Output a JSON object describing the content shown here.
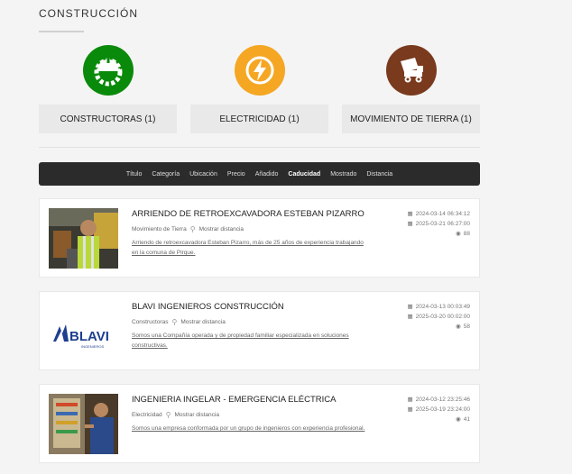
{
  "header": {
    "title": "CONSTRUCCIÓN"
  },
  "categories": [
    {
      "label": "CONSTRUCTORAS (1)",
      "icon": "hardhat-gear-icon",
      "color": "#0a8a0a"
    },
    {
      "label": "ELECTRICIDAD (1)",
      "icon": "lightning-icon",
      "color": "#f5a623"
    },
    {
      "label": "MOVIMIENTO DE TIERRA (1)",
      "icon": "dump-truck-icon",
      "color": "#7a3a1d"
    }
  ],
  "sortbar": {
    "items": [
      "Título",
      "Categoría",
      "Ubicación",
      "Precio",
      "Añadido",
      "Caducidad",
      "Mostrado",
      "Distancia"
    ],
    "active": "Caducidad"
  },
  "listings": [
    {
      "title": "ARRIENDO DE RETROEXCAVADORA ESTEBAN PIZARRO",
      "category": "Movimiento de Tierra",
      "distance": "Mostrar distancia",
      "description": "Arriendo de retroexcavadora Esteban Pizarro, más de 25 años de experiencia trabajando en la comuna de Pirque.",
      "added": "2024-03-14 06:34:12",
      "expires": "2025-03-21 06:27:00",
      "views": "88"
    },
    {
      "title": "BLAVI INGENIEROS CONSTRUCCIÓN",
      "category": "Constructoras",
      "distance": "Mostrar distancia",
      "description": "Somos una Compañía operada y de propiedad familiar especializada en soluciones constructivas.",
      "added": "2024-03-13 00:03:49",
      "expires": "2025-03-20 00:02:00",
      "views": "58",
      "logo_text": "BLAVI",
      "logo_sub": "INGENIEROS"
    },
    {
      "title": "INGENIERIA INGELAR - EMERGENCIA ELÉCTRICA",
      "category": "Electricidad",
      "distance": "Mostrar distancia",
      "description": "Somos una empresa conformada por un grupo de ingenieros con experiencia profesional.",
      "added": "2024-03-12 23:25:46",
      "expires": "2025-03-19 23:24:00",
      "views": "41"
    }
  ]
}
